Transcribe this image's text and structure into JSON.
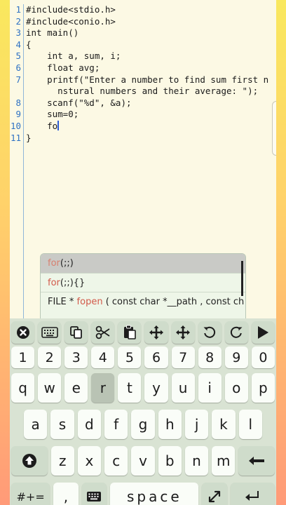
{
  "editor": {
    "line_numbers": [
      "1",
      "2",
      "3",
      "4",
      "5",
      "6",
      "7",
      "8",
      "9",
      "10",
      "11"
    ],
    "lines": [
      "#include<stdio.h>",
      "#include<conio.h>",
      "int main()",
      "{",
      "    int a, sum, i;",
      "    float avg;",
      "    printf(\"Enter a number to find sum first n",
      "      nstural numbers and their average: \");",
      "    scanf(\"%d\", &a);",
      "    sum=0;",
      "    fo",
      "}"
    ]
  },
  "autocomplete": {
    "items": [
      {
        "highlight": "for",
        "rest": "(;;)"
      },
      {
        "highlight": "for",
        "rest": "(;;){}"
      },
      {
        "prefix": "FILE * ",
        "highlight": "fopen",
        "rest": " ( const char *__path ,  const ch"
      }
    ]
  },
  "keyboard": {
    "toolbar": [
      {
        "name": "clear-icon",
        "glyph": "✖"
      },
      {
        "name": "keyboard-icon",
        "glyph": "⌨"
      },
      {
        "name": "copy-icon",
        "glyph": "❐"
      },
      {
        "name": "cut-icon",
        "glyph": "✂"
      },
      {
        "name": "paste-icon",
        "glyph": "📋"
      },
      {
        "name": "move-icon",
        "glyph": "✥"
      },
      {
        "name": "select-move-icon",
        "glyph": "✥"
      },
      {
        "name": "undo-icon",
        "glyph": "↺"
      },
      {
        "name": "redo-icon",
        "glyph": "↻"
      },
      {
        "name": "run-icon",
        "glyph": "▶"
      }
    ],
    "digits": [
      "1",
      "2",
      "3",
      "4",
      "5",
      "6",
      "7",
      "8",
      "9",
      "0"
    ],
    "row_q": [
      "q",
      "w",
      "e",
      "r",
      "t",
      "y",
      "u",
      "i",
      "o",
      "p"
    ],
    "row_a": [
      "a",
      "s",
      "d",
      "f",
      "g",
      "h",
      "j",
      "k",
      "l"
    ],
    "row_z": [
      "z",
      "x",
      "c",
      "v",
      "b",
      "n",
      "m"
    ],
    "symbols_label": "#+=",
    "comma_label": ",",
    "space_label": "space",
    "icons": {
      "shift": "shift-icon",
      "backspace": "backspace-icon",
      "keyboard_switch": "keyboard-switch-icon",
      "expand": "expand-icon",
      "enter": "enter-icon"
    }
  }
}
